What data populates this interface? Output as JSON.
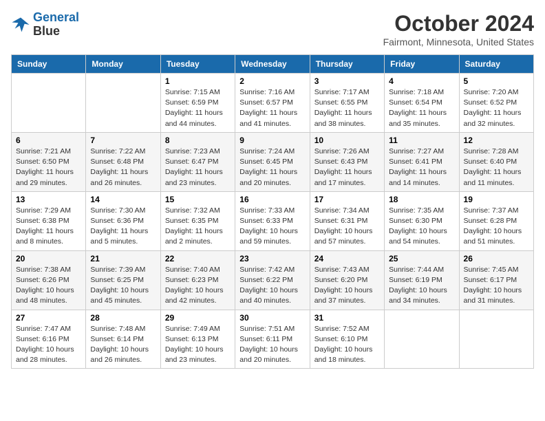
{
  "header": {
    "logo_line1": "General",
    "logo_line2": "Blue",
    "month_title": "October 2024",
    "location": "Fairmont, Minnesota, United States"
  },
  "weekdays": [
    "Sunday",
    "Monday",
    "Tuesday",
    "Wednesday",
    "Thursday",
    "Friday",
    "Saturday"
  ],
  "weeks": [
    [
      {
        "day": "",
        "sunrise": "",
        "sunset": "",
        "daylight": ""
      },
      {
        "day": "",
        "sunrise": "",
        "sunset": "",
        "daylight": ""
      },
      {
        "day": "1",
        "sunrise": "Sunrise: 7:15 AM",
        "sunset": "Sunset: 6:59 PM",
        "daylight": "Daylight: 11 hours and 44 minutes."
      },
      {
        "day": "2",
        "sunrise": "Sunrise: 7:16 AM",
        "sunset": "Sunset: 6:57 PM",
        "daylight": "Daylight: 11 hours and 41 minutes."
      },
      {
        "day": "3",
        "sunrise": "Sunrise: 7:17 AM",
        "sunset": "Sunset: 6:55 PM",
        "daylight": "Daylight: 11 hours and 38 minutes."
      },
      {
        "day": "4",
        "sunrise": "Sunrise: 7:18 AM",
        "sunset": "Sunset: 6:54 PM",
        "daylight": "Daylight: 11 hours and 35 minutes."
      },
      {
        "day": "5",
        "sunrise": "Sunrise: 7:20 AM",
        "sunset": "Sunset: 6:52 PM",
        "daylight": "Daylight: 11 hours and 32 minutes."
      }
    ],
    [
      {
        "day": "6",
        "sunrise": "Sunrise: 7:21 AM",
        "sunset": "Sunset: 6:50 PM",
        "daylight": "Daylight: 11 hours and 29 minutes."
      },
      {
        "day": "7",
        "sunrise": "Sunrise: 7:22 AM",
        "sunset": "Sunset: 6:48 PM",
        "daylight": "Daylight: 11 hours and 26 minutes."
      },
      {
        "day": "8",
        "sunrise": "Sunrise: 7:23 AM",
        "sunset": "Sunset: 6:47 PM",
        "daylight": "Daylight: 11 hours and 23 minutes."
      },
      {
        "day": "9",
        "sunrise": "Sunrise: 7:24 AM",
        "sunset": "Sunset: 6:45 PM",
        "daylight": "Daylight: 11 hours and 20 minutes."
      },
      {
        "day": "10",
        "sunrise": "Sunrise: 7:26 AM",
        "sunset": "Sunset: 6:43 PM",
        "daylight": "Daylight: 11 hours and 17 minutes."
      },
      {
        "day": "11",
        "sunrise": "Sunrise: 7:27 AM",
        "sunset": "Sunset: 6:41 PM",
        "daylight": "Daylight: 11 hours and 14 minutes."
      },
      {
        "day": "12",
        "sunrise": "Sunrise: 7:28 AM",
        "sunset": "Sunset: 6:40 PM",
        "daylight": "Daylight: 11 hours and 11 minutes."
      }
    ],
    [
      {
        "day": "13",
        "sunrise": "Sunrise: 7:29 AM",
        "sunset": "Sunset: 6:38 PM",
        "daylight": "Daylight: 11 hours and 8 minutes."
      },
      {
        "day": "14",
        "sunrise": "Sunrise: 7:30 AM",
        "sunset": "Sunset: 6:36 PM",
        "daylight": "Daylight: 11 hours and 5 minutes."
      },
      {
        "day": "15",
        "sunrise": "Sunrise: 7:32 AM",
        "sunset": "Sunset: 6:35 PM",
        "daylight": "Daylight: 11 hours and 2 minutes."
      },
      {
        "day": "16",
        "sunrise": "Sunrise: 7:33 AM",
        "sunset": "Sunset: 6:33 PM",
        "daylight": "Daylight: 10 hours and 59 minutes."
      },
      {
        "day": "17",
        "sunrise": "Sunrise: 7:34 AM",
        "sunset": "Sunset: 6:31 PM",
        "daylight": "Daylight: 10 hours and 57 minutes."
      },
      {
        "day": "18",
        "sunrise": "Sunrise: 7:35 AM",
        "sunset": "Sunset: 6:30 PM",
        "daylight": "Daylight: 10 hours and 54 minutes."
      },
      {
        "day": "19",
        "sunrise": "Sunrise: 7:37 AM",
        "sunset": "Sunset: 6:28 PM",
        "daylight": "Daylight: 10 hours and 51 minutes."
      }
    ],
    [
      {
        "day": "20",
        "sunrise": "Sunrise: 7:38 AM",
        "sunset": "Sunset: 6:26 PM",
        "daylight": "Daylight: 10 hours and 48 minutes."
      },
      {
        "day": "21",
        "sunrise": "Sunrise: 7:39 AM",
        "sunset": "Sunset: 6:25 PM",
        "daylight": "Daylight: 10 hours and 45 minutes."
      },
      {
        "day": "22",
        "sunrise": "Sunrise: 7:40 AM",
        "sunset": "Sunset: 6:23 PM",
        "daylight": "Daylight: 10 hours and 42 minutes."
      },
      {
        "day": "23",
        "sunrise": "Sunrise: 7:42 AM",
        "sunset": "Sunset: 6:22 PM",
        "daylight": "Daylight: 10 hours and 40 minutes."
      },
      {
        "day": "24",
        "sunrise": "Sunrise: 7:43 AM",
        "sunset": "Sunset: 6:20 PM",
        "daylight": "Daylight: 10 hours and 37 minutes."
      },
      {
        "day": "25",
        "sunrise": "Sunrise: 7:44 AM",
        "sunset": "Sunset: 6:19 PM",
        "daylight": "Daylight: 10 hours and 34 minutes."
      },
      {
        "day": "26",
        "sunrise": "Sunrise: 7:45 AM",
        "sunset": "Sunset: 6:17 PM",
        "daylight": "Daylight: 10 hours and 31 minutes."
      }
    ],
    [
      {
        "day": "27",
        "sunrise": "Sunrise: 7:47 AM",
        "sunset": "Sunset: 6:16 PM",
        "daylight": "Daylight: 10 hours and 28 minutes."
      },
      {
        "day": "28",
        "sunrise": "Sunrise: 7:48 AM",
        "sunset": "Sunset: 6:14 PM",
        "daylight": "Daylight: 10 hours and 26 minutes."
      },
      {
        "day": "29",
        "sunrise": "Sunrise: 7:49 AM",
        "sunset": "Sunset: 6:13 PM",
        "daylight": "Daylight: 10 hours and 23 minutes."
      },
      {
        "day": "30",
        "sunrise": "Sunrise: 7:51 AM",
        "sunset": "Sunset: 6:11 PM",
        "daylight": "Daylight: 10 hours and 20 minutes."
      },
      {
        "day": "31",
        "sunrise": "Sunrise: 7:52 AM",
        "sunset": "Sunset: 6:10 PM",
        "daylight": "Daylight: 10 hours and 18 minutes."
      },
      {
        "day": "",
        "sunrise": "",
        "sunset": "",
        "daylight": ""
      },
      {
        "day": "",
        "sunrise": "",
        "sunset": "",
        "daylight": ""
      }
    ]
  ]
}
